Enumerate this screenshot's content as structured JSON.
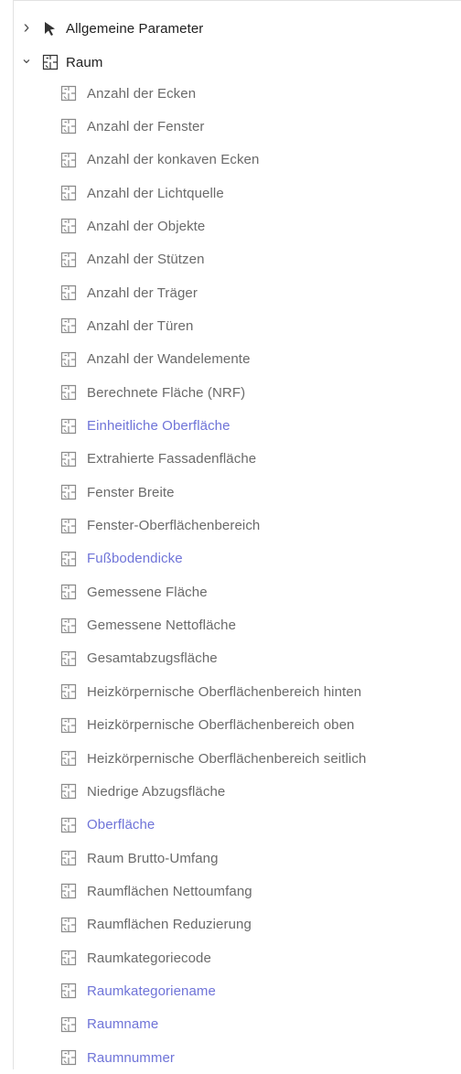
{
  "tree": {
    "roots": [
      {
        "label": "Allgemeine Parameter",
        "icon": "cursor-arrow-icon",
        "expanded": false
      },
      {
        "label": "Raum",
        "icon": "floorplan-icon",
        "expanded": true
      }
    ],
    "children": [
      {
        "label": "Anzahl der Ecken",
        "highlight": false
      },
      {
        "label": "Anzahl der Fenster",
        "highlight": false
      },
      {
        "label": "Anzahl der konkaven Ecken",
        "highlight": false
      },
      {
        "label": "Anzahl der Lichtquelle",
        "highlight": false
      },
      {
        "label": "Anzahl der Objekte",
        "highlight": false
      },
      {
        "label": "Anzahl der Stützen",
        "highlight": false
      },
      {
        "label": "Anzahl der Träger",
        "highlight": false
      },
      {
        "label": "Anzahl der Türen",
        "highlight": false
      },
      {
        "label": "Anzahl der Wandelemente",
        "highlight": false
      },
      {
        "label": "Berechnete Fläche (NRF)",
        "highlight": false
      },
      {
        "label": "Einheitliche Oberfläche",
        "highlight": true
      },
      {
        "label": "Extrahierte Fassadenfläche",
        "highlight": false
      },
      {
        "label": "Fenster Breite",
        "highlight": false
      },
      {
        "label": "Fenster-Oberflächenbereich",
        "highlight": false
      },
      {
        "label": "Fußbodendicke",
        "highlight": true
      },
      {
        "label": "Gemessene Fläche",
        "highlight": false
      },
      {
        "label": "Gemessene Nettofläche",
        "highlight": false
      },
      {
        "label": "Gesamtabzugsfläche",
        "highlight": false
      },
      {
        "label": "Heizkörpernische Oberflächenbereich hinten",
        "highlight": false
      },
      {
        "label": "Heizkörpernische Oberflächenbereich oben",
        "highlight": false
      },
      {
        "label": "Heizkörpernische Oberflächenbereich seitlich",
        "highlight": false
      },
      {
        "label": "Niedrige Abzugsfläche",
        "highlight": false
      },
      {
        "label": "Oberfläche",
        "highlight": true
      },
      {
        "label": "Raum Brutto-Umfang",
        "highlight": false
      },
      {
        "label": "Raumflächen Nettoumfang",
        "highlight": false
      },
      {
        "label": "Raumflächen Reduzierung",
        "highlight": false
      },
      {
        "label": "Raumkategoriecode",
        "highlight": false
      },
      {
        "label": "Raumkategoriename",
        "highlight": true
      },
      {
        "label": "Raumname",
        "highlight": true
      },
      {
        "label": "Raumnummer",
        "highlight": true
      }
    ]
  },
  "colors": {
    "highlight": "#6f74d8",
    "childText": "#6a6a6a",
    "rootText": "#1f1f1f"
  }
}
